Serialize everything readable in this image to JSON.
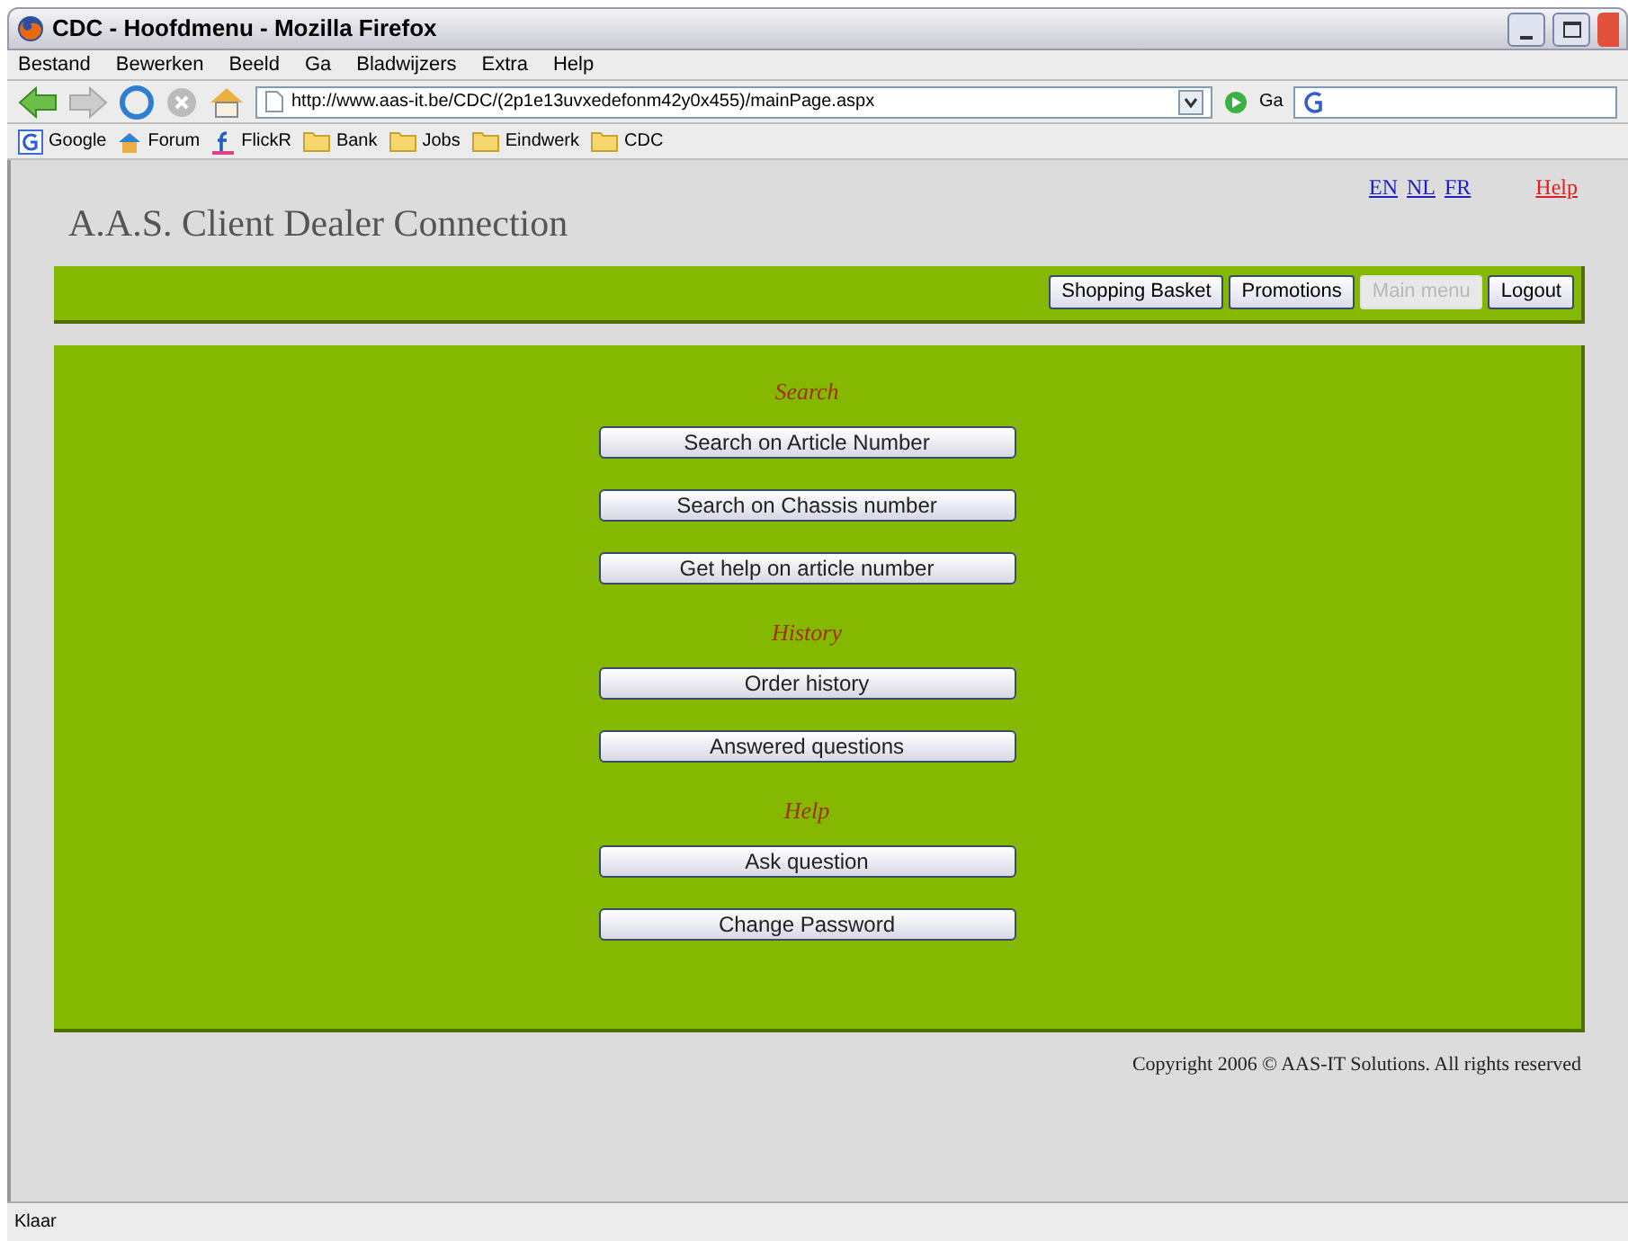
{
  "window": {
    "title": "CDC - Hoofdmenu - Mozilla Firefox"
  },
  "menu": [
    "Bestand",
    "Bewerken",
    "Beeld",
    "Ga",
    "Bladwijzers",
    "Extra",
    "Help"
  ],
  "address_bar": {
    "value": "http://www.aas-it.be/CDC/(2p1e13uvxedefonm42y0x455)/mainPage.aspx"
  },
  "go_button": "Ga",
  "bookmarks": [
    {
      "label": "Google",
      "kind": "google"
    },
    {
      "label": "Forum",
      "kind": "forum"
    },
    {
      "label": "FlickR",
      "kind": "flickr"
    },
    {
      "label": "Bank",
      "kind": "folder"
    },
    {
      "label": "Jobs",
      "kind": "folder"
    },
    {
      "label": "Eindwerk",
      "kind": "folder"
    },
    {
      "label": "CDC",
      "kind": "folder"
    }
  ],
  "page": {
    "languages": [
      "EN",
      "NL",
      "FR"
    ],
    "help_link": "Help",
    "site_title": "A.A.S. Client Dealer Connection",
    "nav_buttons": [
      {
        "label": "Shopping Basket",
        "disabled": false
      },
      {
        "label": "Promotions",
        "disabled": false
      },
      {
        "label": "Main menu",
        "disabled": true
      },
      {
        "label": "Logout",
        "disabled": false
      }
    ],
    "sections": [
      {
        "heading": "Search",
        "buttons": [
          "Search on Article Number",
          "Search on Chassis number",
          "Get help on article number"
        ]
      },
      {
        "heading": "History",
        "buttons": [
          "Order history",
          "Answered questions"
        ]
      },
      {
        "heading": "Help",
        "buttons": [
          "Ask question",
          "Change Password"
        ]
      }
    ],
    "copyright": "Copyright 2006 © AAS-IT Solutions. All rights reserved"
  },
  "status_bar": {
    "text": "Klaar"
  }
}
